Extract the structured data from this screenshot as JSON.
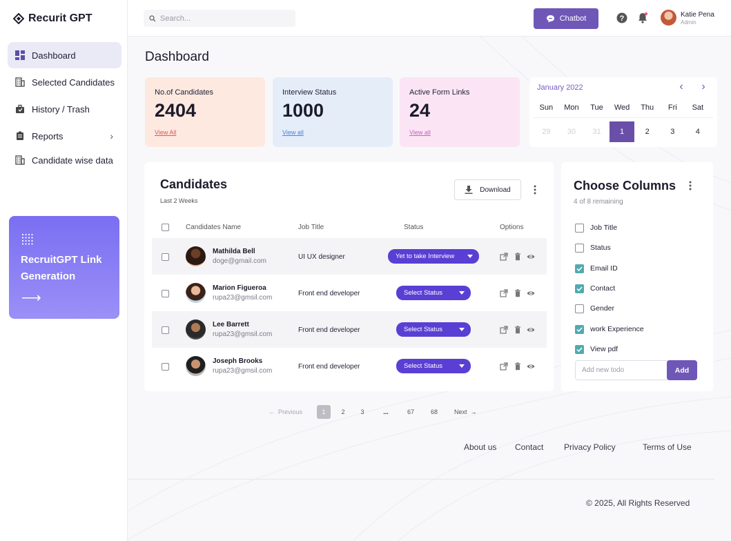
{
  "brand": {
    "name": "Recurit GPT"
  },
  "sidebar": {
    "items": [
      {
        "label": "Dashboard",
        "icon": "dashboard-icon",
        "active": true
      },
      {
        "label": "Selected Candidates",
        "icon": "building-icon"
      },
      {
        "label": "History / Trash",
        "icon": "briefcase-icon"
      },
      {
        "label": "Reports",
        "icon": "clipboard-icon",
        "has_submenu": true
      },
      {
        "label": "Candidate wise data",
        "icon": "building-icon"
      }
    ],
    "promo": {
      "label": "RecruitGPT Link Generation",
      "arrow": "⟶"
    }
  },
  "topbar": {
    "search_placeholder": "Search...",
    "chatbot_label": "Chatbot",
    "user": {
      "name": "Katie Pena",
      "role": "Admin"
    }
  },
  "page": {
    "title": "Dashboard"
  },
  "stats": [
    {
      "label": "No.of Candidates",
      "value": "2404",
      "link": "View All",
      "bg": "#fde9e0",
      "link_color": "#e05555"
    },
    {
      "label": "Interview Status",
      "value": "1000",
      "link": "View all",
      "bg": "#e5edf9",
      "link_color": "#4a7fe0"
    },
    {
      "label": "Active Form Links",
      "value": "24",
      "link": "View all",
      "bg": "#fbe5f4",
      "link_color": "#c65fc6"
    }
  ],
  "calendar": {
    "title": "January 2022",
    "days": [
      "Sun",
      "Mon",
      "Tue",
      "Wed",
      "Thu",
      "Fri",
      "Sat"
    ],
    "dates": [
      "29",
      "30",
      "31",
      "1",
      "2",
      "3",
      "4"
    ],
    "selected": "1"
  },
  "candidates": {
    "title": "Candidates",
    "subtitle": "Last 2 Weeks",
    "download_label": "Download",
    "columns": {
      "name": "Candidates Name",
      "job": "Job Title",
      "status": "Status",
      "options": "Options"
    },
    "rows": [
      {
        "name": "Mathilda Bell",
        "email": "doge@gmail.com",
        "job": "UI UX designer",
        "status": "Yet to take Interview"
      },
      {
        "name": "Marion Figueroa",
        "email": "rupa23@gmsil.com",
        "job": "Front end developer",
        "status": "Select Status"
      },
      {
        "name": "Lee Barrett",
        "email": "rupa23@gmsil.com",
        "job": "Front end developer",
        "status": "Select Status"
      },
      {
        "name": "Joseph Brooks",
        "email": "rupa23@gmsil.com",
        "job": "Front end developer",
        "status": "Select Status"
      }
    ]
  },
  "pagination": {
    "previous": "Previous",
    "pages": [
      "1",
      "2",
      "3",
      "...",
      "67",
      "68"
    ],
    "current": "1",
    "next": "Next"
  },
  "columns_panel": {
    "title": "Choose Columns",
    "subtitle": "4 of 8 remaining",
    "items": [
      {
        "label": "Job Title",
        "checked": false
      },
      {
        "label": "Status",
        "checked": false
      },
      {
        "label": "Email ID",
        "checked": true
      },
      {
        "label": "Contact",
        "checked": true
      },
      {
        "label": "Gender",
        "checked": false
      },
      {
        "label": "work Experience",
        "checked": true
      },
      {
        "label": "View pdf",
        "checked": true
      }
    ],
    "todo_placeholder": "Add new todo",
    "add_label": "Add"
  },
  "footer": {
    "links": [
      "About us",
      "Contact",
      "Privacy Policy",
      "Terms of Use"
    ],
    "copyright": "© 2025, All Rights Reserved"
  },
  "colors": {
    "accent": "#6f57b8",
    "status_button": "#5a3fd4",
    "checked": "#52aab0"
  }
}
